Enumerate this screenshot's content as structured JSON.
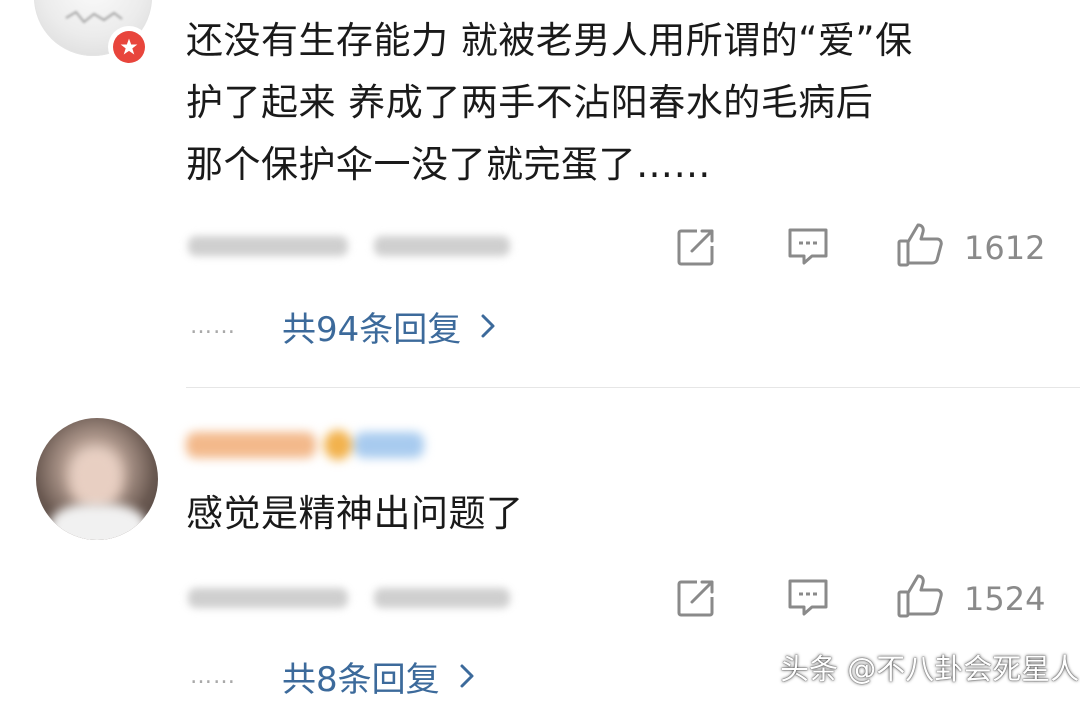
{
  "comments": [
    {
      "text": "还没有生存能力 就被老男人用所谓的“爱”保\n护了起来 养成了两手不沾阳春水的毛病后\n那个保护伞一没了就完蛋了……",
      "like_count": "1612",
      "replies_label": "共94条回复",
      "more_indicator": "……"
    },
    {
      "text": "感觉是精神出问题了",
      "like_count": "1524",
      "replies_label": "共8条回复",
      "more_indicator": "……"
    }
  ],
  "icons": {
    "share": "share-icon",
    "reply": "comment-icon",
    "like": "thumbs-up-icon",
    "chevron": "chevron-right-icon",
    "badge": "vip-badge-icon"
  },
  "colors": {
    "link": "#3c6a9b",
    "text": "#1a1a1a",
    "meta": "#8a8a8a",
    "badge": "#e8453c"
  },
  "watermark": "头条 @不八卦会死星人"
}
